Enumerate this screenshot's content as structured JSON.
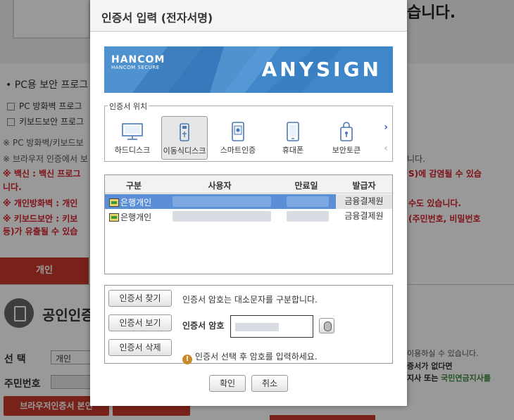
{
  "background": {
    "hero_text": "습니다.",
    "pc_security_title": "• PC용 보안 프로그",
    "checkbox_firewall": "PC 방화벽 프로그",
    "checkbox_keyboard": "키보드보안 프로그",
    "note1": "※ PC 방화벽/키보드보",
    "note2": "※ 브라우저 인증에서 보",
    "note2_right": "니다.",
    "warn_vaccine": "※ 백신 : 백신 프로그",
    "warn_vaccine_right": "S)에 감염될 수 있습",
    "warn_vaccine_cont": "니다.",
    "warn_firewall": "※ 개인방화벽 : 개인",
    "warn_firewall_right": "수도 있습니다.",
    "warn_keyboard": "※ 키보드보안 : 키보",
    "warn_keyboard_right": "(주민번호, 비밀번호",
    "warn_keyboard_cont": "등)가 유출될 수 있습",
    "tab_personal": "개인",
    "cert_title": "공인인증",
    "select_label": "선    택",
    "select_value": "개인",
    "rrn_label": "주민번호",
    "browser_cert_button": "브라우저인증서 본인",
    "right_note1": "이용하실 수 있습니다.",
    "right_note2": "증서가 없다면",
    "right_note3a": "지사 또는 ",
    "right_note3b": "국민연금지사를"
  },
  "dialog": {
    "title": "인증서 입력 (전자서명)",
    "banner": {
      "brand": "HANCOM",
      "brand_sub": "HANCOM SECURE",
      "product": "ANYSIGN"
    },
    "location_legend": "인증서 위치",
    "locations": [
      {
        "label": "하드디스크",
        "icon": "monitor-icon",
        "selected": false
      },
      {
        "label": "이동식디스크",
        "icon": "usb-icon",
        "selected": true
      },
      {
        "label": "스마트인증",
        "icon": "smart-cert-icon",
        "selected": false
      },
      {
        "label": "휴대폰",
        "icon": "phone-icon",
        "selected": false
      },
      {
        "label": "보안토큰",
        "icon": "security-token-icon",
        "selected": false
      }
    ],
    "nav_next": "›",
    "nav_prev": "‹",
    "table": {
      "headers": {
        "type": "구분",
        "user": "사용자",
        "expiry": "만료일",
        "issuer": "발급자"
      },
      "rows": [
        {
          "type": "은행개인",
          "issuer": "금융결제원"
        },
        {
          "type": "은행개인",
          "issuer": "금융결제원"
        }
      ]
    },
    "buttons": {
      "find": "인증서 찾기",
      "view": "인증서 보기",
      "delete": "인증서 삭제",
      "ok": "확인",
      "cancel": "취소"
    },
    "case_note": "인증서 암호는 대소문자를 구분합니다.",
    "password_label": "인증서 암호",
    "hint_icon": "!",
    "hint": "인증서 선택 후 암호를 입력하세요."
  }
}
